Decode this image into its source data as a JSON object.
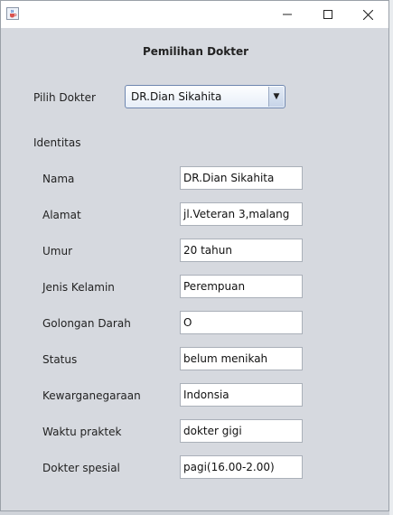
{
  "window": {
    "app_icon": "java-cup-icon",
    "controls": [
      "minimize-icon",
      "maximize-icon",
      "close-icon"
    ]
  },
  "form": {
    "title": "Pemilihan Dokter",
    "select_label": "Pilih Dokter",
    "selected_doctor": "DR.Dian Sikahita",
    "section_label": "Identitas"
  },
  "fields": [
    {
      "label": "Nama",
      "value": "DR.Dian Sikahita"
    },
    {
      "label": "Alamat",
      "value": "jl.Veteran 3,malang"
    },
    {
      "label": "Umur",
      "value": "20 tahun"
    },
    {
      "label": "Jenis Kelamin",
      "value": "Perempuan"
    },
    {
      "label": "Golongan Darah",
      "value": "O"
    },
    {
      "label": "Status",
      "value": "belum menikah"
    },
    {
      "label": "Kewarganegaraan",
      "value": "Indonsia"
    },
    {
      "label": "Waktu praktek",
      "value": "dokter gigi"
    },
    {
      "label": "Dokter spesial",
      "value": "pagi(16.00-2.00)"
    }
  ]
}
